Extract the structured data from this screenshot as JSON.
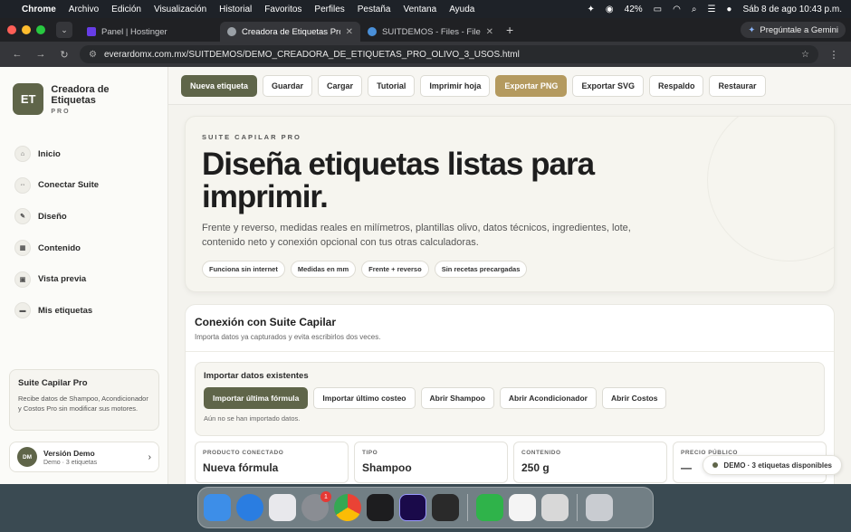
{
  "menubar": {
    "app": "Chrome",
    "items": [
      "Archivo",
      "Edición",
      "Visualización",
      "Historial",
      "Favoritos",
      "Perfiles",
      "Pestaña",
      "Ventana",
      "Ayuda"
    ],
    "battery": "42%",
    "datetime": "Sáb 8 de ago  10:43 p.m."
  },
  "browser": {
    "tabs": [
      {
        "title": "Panel | Hostinger",
        "color": "#673de6"
      },
      {
        "title": "Creadora de Etiquetas Pro - S",
        "color": "#9aa0a6"
      },
      {
        "title": "SUITDEMOS - Files - File Bro",
        "color": "#4a90d9"
      }
    ],
    "gemini": "Pregúntale a Gemini",
    "url": "everardomx.com.mx/SUITDEMOS/DEMO_CREADORA_DE_ETIQUETAS_PRO_OLIVO_3_USOS.html"
  },
  "sidebar": {
    "logo": "ET",
    "title": "Creadora de Etiquetas",
    "subtitle": "PRO",
    "items": [
      {
        "label": "Inicio",
        "icon": "home-icon",
        "glyph": "⌂"
      },
      {
        "label": "Conectar Suite",
        "icon": "link-icon",
        "glyph": "⇔"
      },
      {
        "label": "Diseño",
        "icon": "brush-icon",
        "glyph": "✎"
      },
      {
        "label": "Contenido",
        "icon": "content-icon",
        "glyph": "▦"
      },
      {
        "label": "Vista previa",
        "icon": "preview-icon",
        "glyph": "▣"
      },
      {
        "label": "Mis etiquetas",
        "icon": "labels-icon",
        "glyph": "▬"
      }
    ],
    "suite_title": "Suite Capilar Pro",
    "suite_text": "Recibe datos de Shampoo, Acondicionador y Costos Pro sin modificar sus motores.",
    "demo_initials": "DM",
    "demo_title": "Versión Demo",
    "demo_sub": "Demo · 3 etiquetas"
  },
  "toolbar": {
    "buttons": [
      "Nueva etiqueta",
      "Guardar",
      "Cargar",
      "Tutorial",
      "Imprimir hoja",
      "Exportar PNG",
      "Exportar SVG",
      "Respaldo",
      "Restaurar"
    ]
  },
  "hero": {
    "eyebrow": "SUITE CAPILAR PRO",
    "title": "Diseña etiquetas listas para imprimir.",
    "description": "Frente y reverso, medidas reales en milímetros, plantillas olivo, datos técnicos, ingredientes, lote, contenido neto y conexión opcional con tus otras calculadoras.",
    "chips": [
      "Funciona sin internet",
      "Medidas en mm",
      "Frente + reverso",
      "Sin recetas precargadas"
    ]
  },
  "connection": {
    "title": "Conexión con Suite Capilar",
    "subtitle": "Importa datos ya capturados y evita escribirlos dos veces.",
    "import_title": "Importar datos existentes",
    "import_buttons": [
      "Importar última fórmula",
      "Importar último costeo",
      "Abrir Shampoo",
      "Abrir Acondicionador",
      "Abrir Costos"
    ],
    "import_note": "Aún no se han importado datos.",
    "fields": [
      {
        "label": "PRODUCTO CONECTADO",
        "value": "Nueva fórmula"
      },
      {
        "label": "TIPO",
        "value": "Shampoo"
      },
      {
        "label": "CONTENIDO",
        "value": "250 g"
      },
      {
        "label": "PRECIO PÚBLICO",
        "value": "—"
      }
    ]
  },
  "toast": "DEMO · 3 etiquetas disponibles",
  "dock": {
    "badge": "1",
    "apps": [
      {
        "name": "finder-icon",
        "color": "#3d8ee8"
      },
      {
        "name": "safari-icon",
        "color": "#2a7de1"
      },
      {
        "name": "launchpad-icon",
        "color": "#e8e8ec"
      },
      {
        "name": "settings-icon",
        "color": "#8a8d93"
      },
      {
        "name": "chrome-icon",
        "color": "#ffffff"
      },
      {
        "name": "terminal-icon",
        "color": "#1d1d1f"
      },
      {
        "name": "premiere-icon",
        "color": "#1a0a4a"
      },
      {
        "name": "cube-app-icon",
        "color": "#2a2a2a"
      },
      {
        "name": "numbers-icon",
        "color": "#2fb34a"
      },
      {
        "name": "notes-icon",
        "color": "#f4f4f4"
      },
      {
        "name": "calculator-icon",
        "color": "#d8d8d8"
      },
      {
        "name": "trash-icon",
        "color": "#c9ccd1"
      }
    ]
  }
}
